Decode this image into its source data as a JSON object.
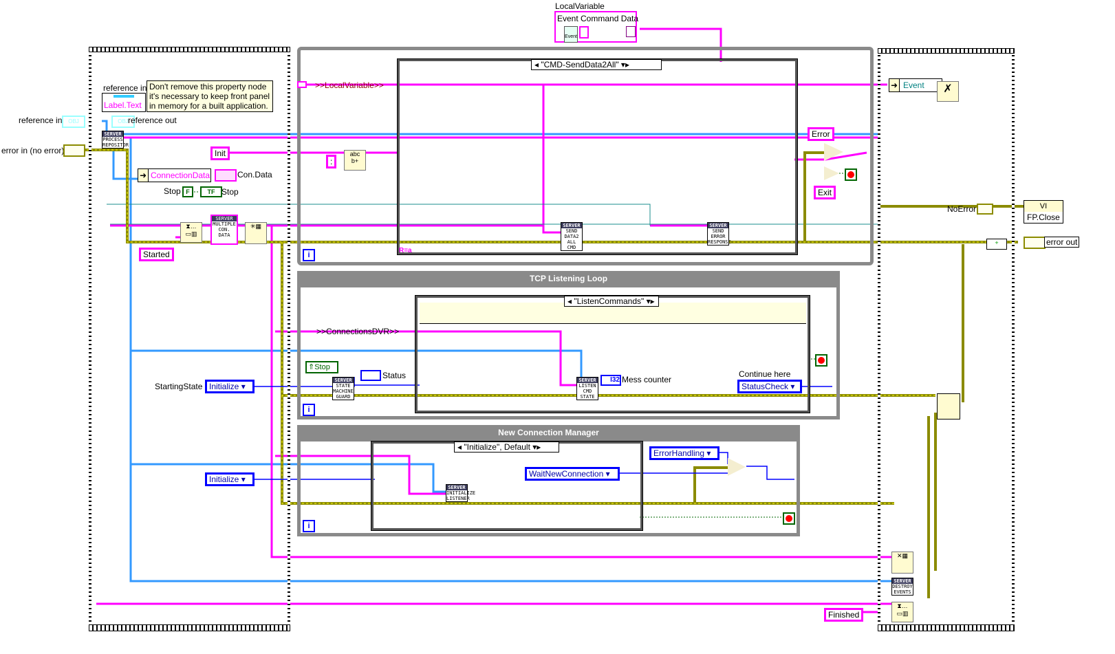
{
  "colors": {
    "string_wire": "#ff00ff",
    "error_wire": "#8b8b00",
    "refnum_wire": "#3399ff",
    "enum_wire": "#0000ff",
    "bool_wire": "#006400",
    "cluster_wire": "#008080",
    "loop_frame": "#8a8a8a",
    "note_bg": "#ffffe1"
  },
  "top": {
    "local_variable_label": "LocalVariable",
    "event_command_data": "Event Command Data",
    "event_icon_text": "Event"
  },
  "left_frame": {
    "reference_in_label": "reference in",
    "reference_in_ctrl": "OBJ",
    "reference_out_label": "reference out",
    "reference_out_ctrl": "OBJ",
    "error_in_label": "error in (no error)",
    "property_node_ref": "reference in",
    "property_node_prop": "Label.Text",
    "note_text": "Don't remove this property node it's necessary to keep front panel in memory for a built application.",
    "process_repository": [
      "SERVER",
      "PROCESS",
      "REPOSITOR"
    ],
    "connection_data_bundle": "ConnectionData",
    "con_data_label": "Con.Data",
    "stop_label_left": "Stop",
    "stop_const": "F",
    "stop_ind": "TF",
    "stop_label_right": "Stop",
    "multiple_con_data": [
      "SERVER",
      "MULTIPLE",
      "CON.",
      "DATA"
    ],
    "started_const": "Started",
    "starting_state_label": "StartingState",
    "starting_state_value": "Initialize",
    "ncm_state_value": "Initialize"
  },
  "event_loop": {
    "case_selector": "\"CMD-SendData2All\"",
    "local_variable_shift": ">>LocalVariable>>",
    "init_const": "Init",
    "colon_const": ":",
    "send_data_subvi": [
      "SERVER",
      "SEND",
      "DATA2 ALL",
      "CMD"
    ],
    "send_error_subvi": [
      "SERVER",
      "SEND",
      "ERROR",
      "RESPONSE"
    ],
    "error_const": "Error",
    "exit_const": "Exit",
    "iteration": "i",
    "format_indicator": "R=a"
  },
  "tcp_loop": {
    "title": "TCP Listening Loop",
    "case_selector": "\"ListenCommands\"",
    "connections_shift": ">>ConnectionsDVR>>",
    "stop_local": "Stop",
    "guard_subvi": [
      "SERVER",
      "STATE",
      "MACHINE",
      "GUARD"
    ],
    "status_label": "Status",
    "listen_subvi": [
      "SERVER",
      "LISTEN",
      "CMD",
      "STATE"
    ],
    "mess_counter_type": "I32",
    "mess_counter_label": "Mess counter",
    "continue_here_label": "Continue here",
    "status_check_value": "StatusCheck",
    "iteration": "i"
  },
  "ncm_loop": {
    "title": "New Connection Manager",
    "case_selector": "\"Initialize\", Default",
    "initialize_listener": [
      "SERVER",
      "INITIALIZE",
      "LISTENER"
    ],
    "wait_new_connection": "WaitNewConnection",
    "error_handling": "ErrorHandling",
    "iteration": "i"
  },
  "right_frame": {
    "event_unbundle": "Event",
    "no_error_label": "NoError",
    "fp_close_header": "VI",
    "fp_close_prop": "FP.Close",
    "error_out_label": "error out",
    "destroy_events": [
      "SERVER",
      "DESTROY",
      "EVENTS"
    ],
    "finished_const": "Finished"
  }
}
